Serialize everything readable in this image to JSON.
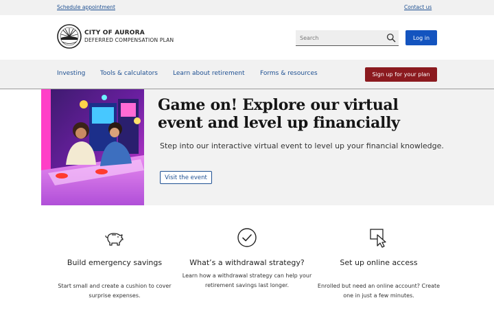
{
  "utility": {
    "schedule": "Schedule appointment",
    "contact": "Contact us"
  },
  "brand": {
    "name": "CITY OF AURORA",
    "subtitle": "DEFERRED COMPENSATION PLAN",
    "logo_icon": "aurora-city-seal-icon"
  },
  "search": {
    "placeholder": "Search",
    "icon": "search-icon"
  },
  "header": {
    "login_label": "Log in"
  },
  "nav": {
    "items": [
      {
        "label": "Investing"
      },
      {
        "label": "Tools & calculators"
      },
      {
        "label": "Learn about retirement"
      },
      {
        "label": "Forms & resources"
      }
    ],
    "signup_label": "Sign up for your plan"
  },
  "hero": {
    "title": "Game on! Explore our virtual event and level up financially",
    "text": "Step into our interactive virtual event to level up your financial knowledge.",
    "button_label": "Visit the event"
  },
  "cards": [
    {
      "icon": "piggy-bank-icon",
      "title": "Build emergency savings",
      "text": "Start small and create a cushion to cover surprise expenses."
    },
    {
      "icon": "checkmark-circle-icon",
      "title": "What’s a withdrawal strategy?",
      "text": "Learn how a withdrawal strategy can help your retirement savings last longer."
    },
    {
      "icon": "cursor-click-icon",
      "title": "Set up online access",
      "text": "Enrolled but need an online account? Create one in just a few minutes."
    }
  ],
  "colors": {
    "primary_blue": "#1454bf",
    "link_blue": "#1d4f91",
    "signup_red": "#8b1a1f",
    "panel_gray": "#f1f1f1"
  }
}
